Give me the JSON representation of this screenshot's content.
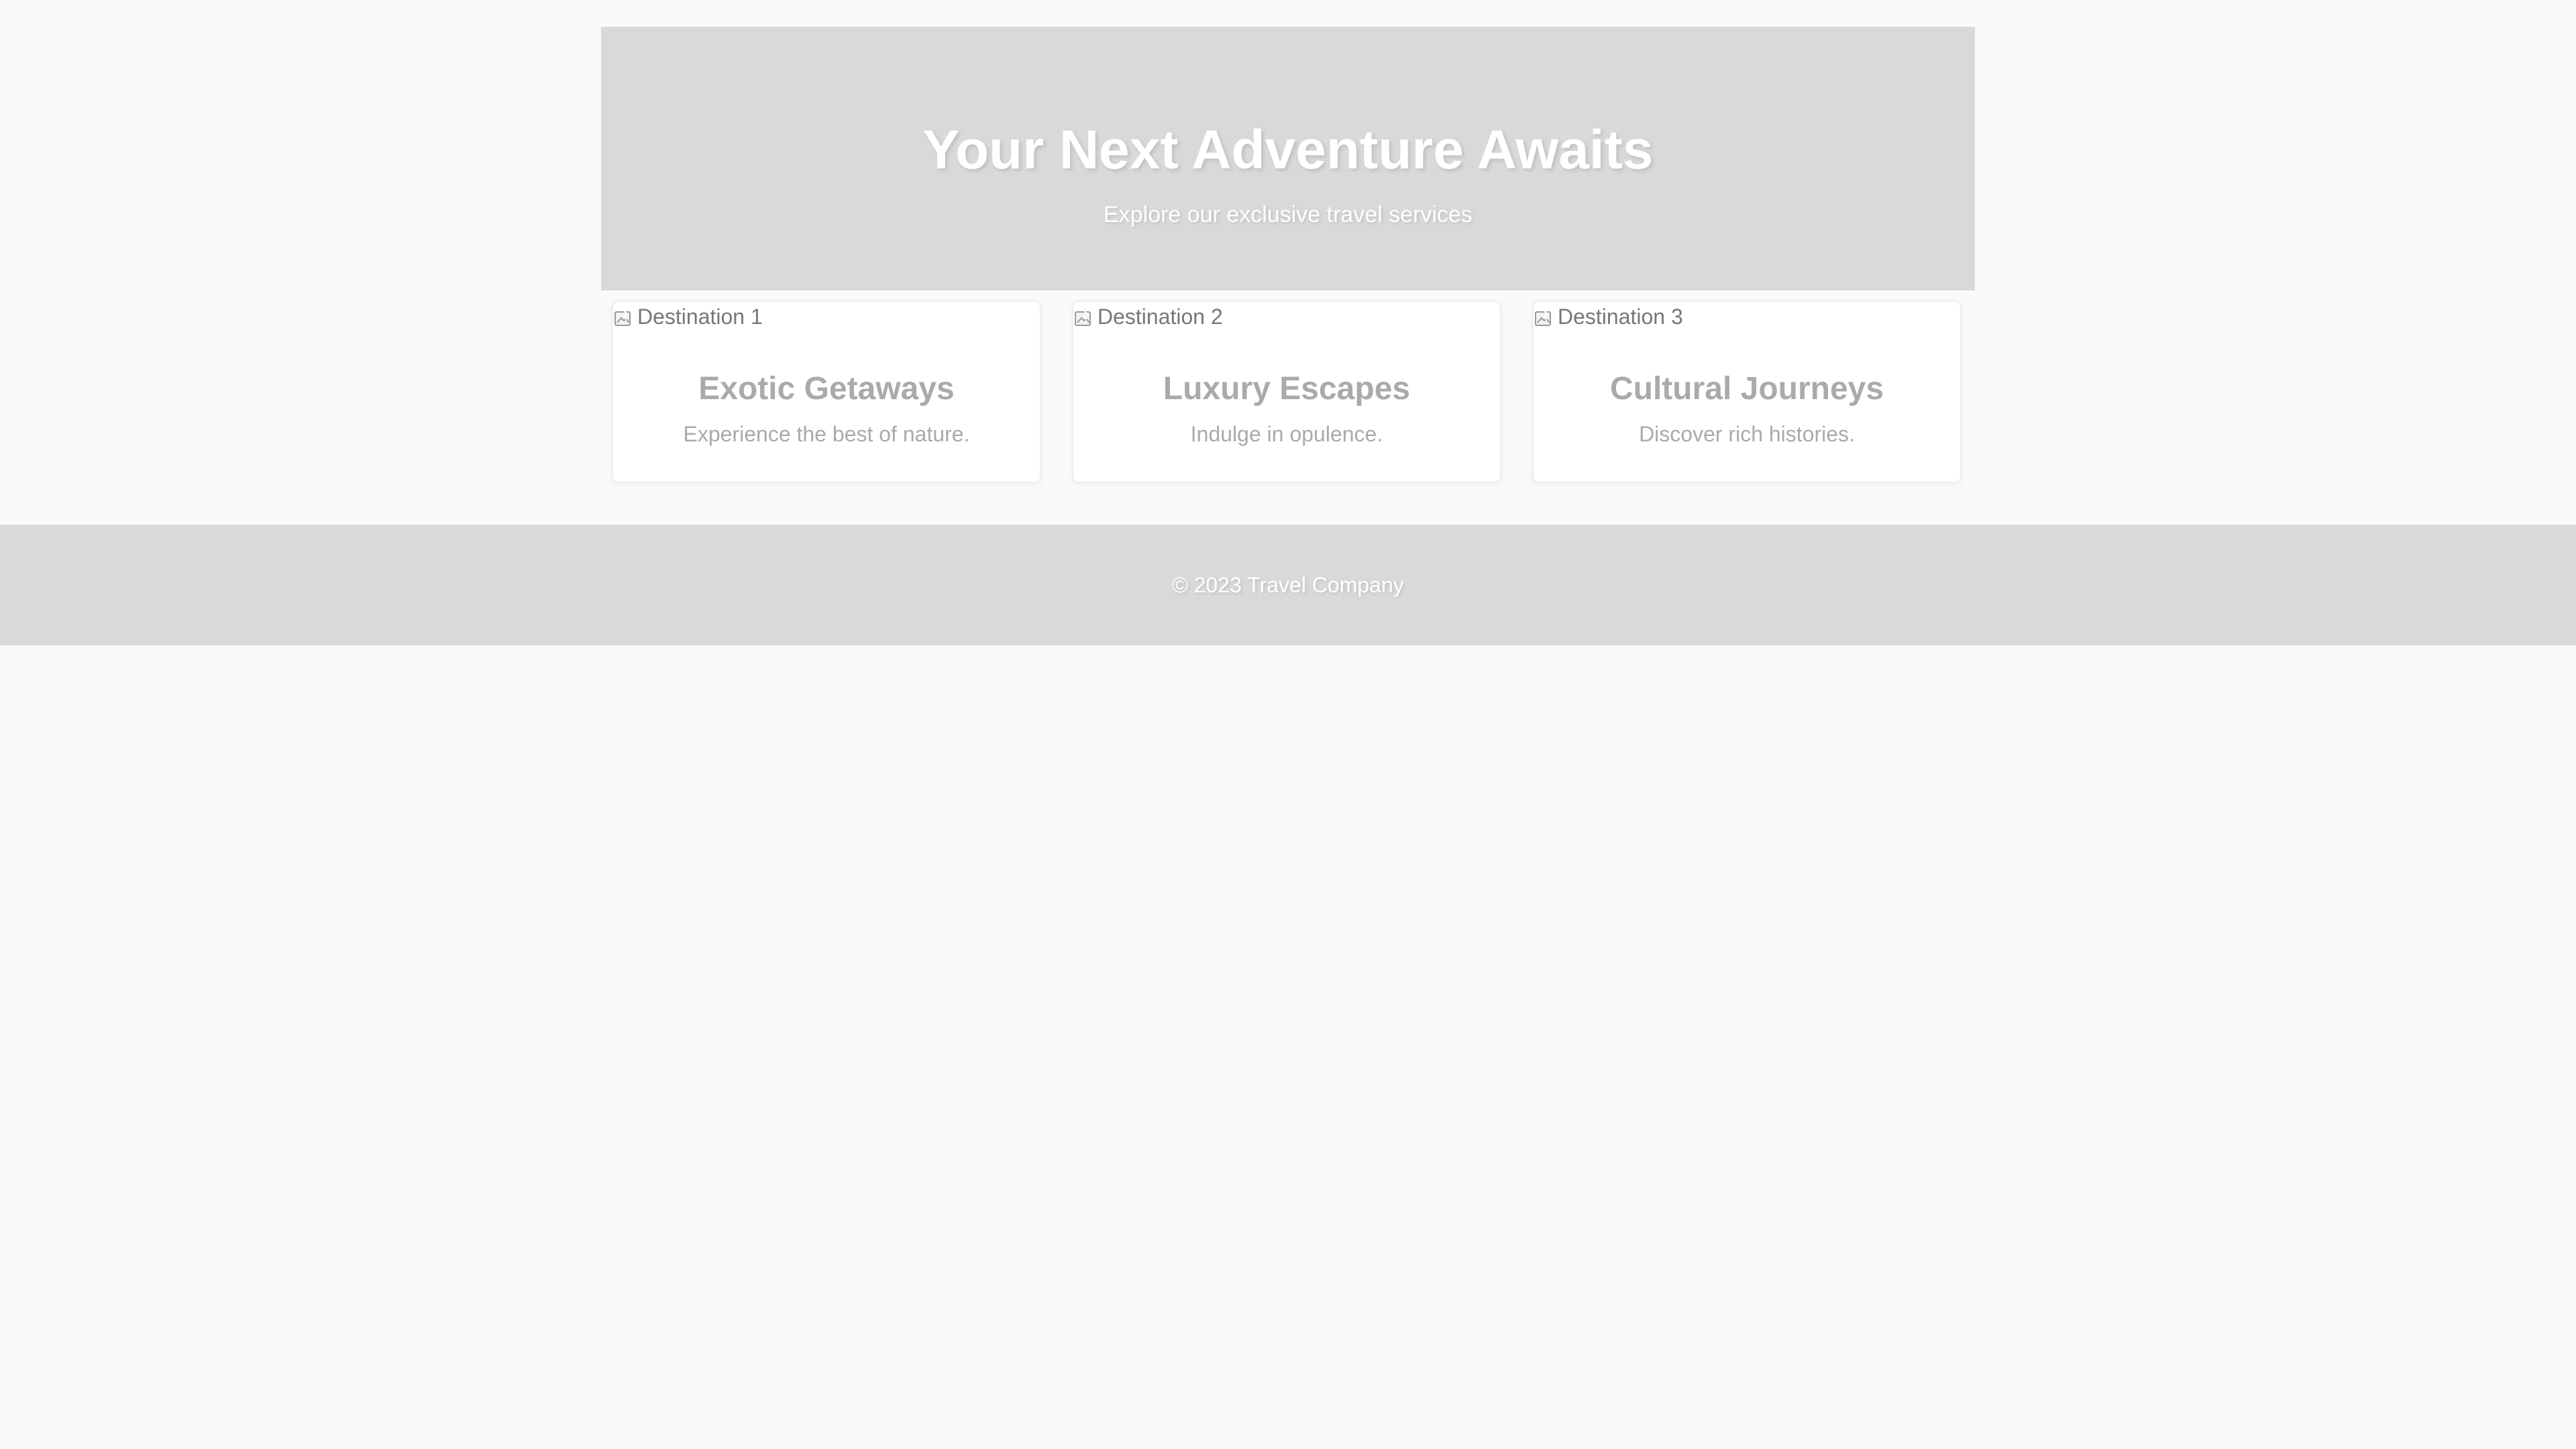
{
  "hero": {
    "title": "Your Next Adventure Awaits",
    "subtitle": "Explore our exclusive travel services"
  },
  "cards": [
    {
      "image_alt": "Destination 1",
      "title": "Exotic Getaways",
      "description": "Experience the best of nature."
    },
    {
      "image_alt": "Destination 2",
      "title": "Luxury Escapes",
      "description": "Indulge in opulence."
    },
    {
      "image_alt": "Destination 3",
      "title": "Cultural Journeys",
      "description": "Discover rich histories."
    }
  ],
  "footer": {
    "copyright": "© 2023 Travel Company"
  },
  "colors": {
    "background": "#fafafa",
    "hero_background": "#d9d9d9",
    "footer_background": "#d9d9d9",
    "card_background": "#ffffff",
    "muted_text": "#aaaaaa"
  },
  "icons": {
    "broken_image": "broken-image-icon"
  }
}
